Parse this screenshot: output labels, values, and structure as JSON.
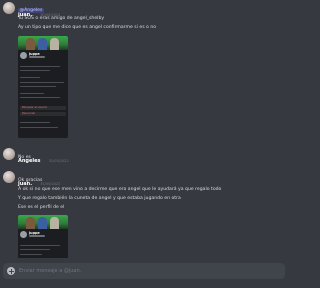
{
  "messages": [
    {
      "author": "juan.",
      "timestamp": "30/05/2022",
      "mention": "@Angeles",
      "lines": [
        "Tu SOS o eras amigo de angel_shelby",
        "Ay un tipo que me dice que es angel confirmarme si es o no"
      ],
      "attachment": {
        "profile_name": "juppe",
        "menu_items": [
          "Bloquear al usuario",
          "Denunciar"
        ]
      }
    },
    {
      "author": "Angeles",
      "timestamp": "31/05/2022",
      "lines": [
        "No es"
      ]
    },
    {
      "author": "juan.",
      "timestamp": "31/05/2022",
      "lines": [
        "Ok gracias",
        "A ok si no que ese men vino a decirme que era angel que le ayudará ya que regalo todo",
        "Y que regalo también la cuneta de angel y que estaba jugando en otra",
        "Ese es el perfil de el"
      ],
      "attachment": {
        "profile_name": "juppe"
      }
    }
  ],
  "composer": {
    "placeholder": "Enviar mensaje a @juan."
  },
  "colors": {
    "background": "#36393f",
    "input": "#40444b",
    "mention_bg": "#5865f2"
  }
}
